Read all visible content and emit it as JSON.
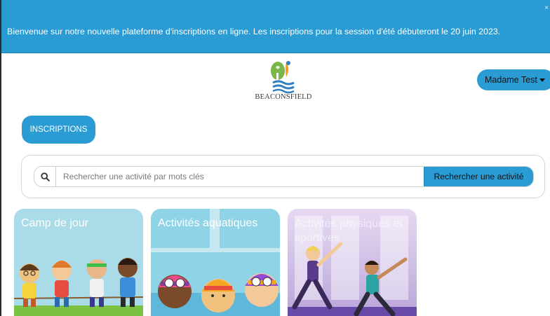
{
  "banner": {
    "message": "Bienvenue sur notre nouvelle plateforme d'inscriptions en ligne. Les inscriptions pour la session d'été débuteront le 20 juin 2023.",
    "close_glyph": "×"
  },
  "header": {
    "logo_text": "BEACONSFIELD",
    "user_menu_label": "Madame Test"
  },
  "nav": {
    "inscriptions_label": "INSCRIPTIONS"
  },
  "search": {
    "icon": "search-icon",
    "placeholder": "Rechercher une activité par mots clés",
    "value": "",
    "submit_label": "Rechercher une activité"
  },
  "categories": [
    {
      "title": "Camp de jour"
    },
    {
      "title": "Activités aquatiques"
    },
    {
      "title": "Activités physiques et sportives"
    }
  ],
  "colors": {
    "accent": "#2b9bd3",
    "banner_text": "#ffffff",
    "logo_green": "#7ab648",
    "logo_orange": "#f39c1f",
    "logo_blue": "#2f7fc1"
  }
}
